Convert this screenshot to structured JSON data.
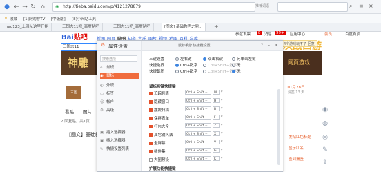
{
  "browser": {
    "url": "http://tieba.baidu.com/p/4121278879",
    "toolbar_right": "推荐词语",
    "favorites": [
      "收藏",
      "[1]网购秒TV",
      "[中级版]",
      "[8]小网站工具"
    ],
    "tabs": [
      "hao123_上网从这里开始",
      "三国志11吧_百度贴吧",
      "三国志11吧_百度贴吧",
      "[图文] 基础教程之完..."
    ]
  },
  "page": {
    "logo_main": "Bai",
    "logo_accent": "贴吧",
    "nav": [
      "新闻",
      "网页",
      "贴吧",
      "知道",
      "音乐",
      "图片",
      "视频",
      "地图",
      "百科",
      "文库"
    ],
    "nav_current": "贴吧",
    "search_value": "三国志11",
    "top_right": [
      "参献发票",
      "8",
      "消息",
      "99+",
      "应用中心",
      "会员",
      "百度首页"
    ],
    "notice": "4个游戏玩不了 回复",
    "banner_left": "神雕",
    "banner_right": "网页游戏",
    "game_tag": "决战西游",
    "forum_img": "三国",
    "sign": {
      "date": "01月28日",
      "status": "漏签 13 天"
    },
    "tabs2": [
      "看贴",
      "图片"
    ],
    "stats": "2 回复贴，共1页",
    "post_title": "【图文】基础教",
    "right_links": [
      "发帖红色标题",
      "显示红名",
      "签到漏签"
    ]
  },
  "dialog": {
    "title": "属性设置",
    "search_placeholder": "搜索选项",
    "side_items": [
      {
        "icon": "home-icon",
        "glyph": "⌂",
        "label": "常规"
      },
      {
        "icon": "mouse-icon",
        "glyph": "◉",
        "label": "鼠标"
      },
      {
        "icon": "appearance-icon",
        "glyph": "◐",
        "label": "外观"
      },
      {
        "icon": "tab-icon",
        "glyph": "▭",
        "label": "标签"
      },
      {
        "icon": "account-icon",
        "glyph": "☺",
        "label": "帐户"
      },
      {
        "icon": "advanced-icon",
        "glyph": "⚙",
        "label": "高级"
      },
      {
        "icon": "addon-icon",
        "glyph": "▣",
        "label": "插入选择器"
      },
      {
        "icon": "addon2-icon",
        "glyph": "▣",
        "label": "插入选择器"
      },
      {
        "icon": "shortcut-icon",
        "glyph": "✎",
        "label": "快捷设置列表"
      }
    ],
    "active_index": 1,
    "inner_title": "鼠标手势 快捷键设置",
    "options": [
      {
        "label": "三键设置",
        "choices": [
          "左右键",
          "双击右键",
          "另单击左键"
        ],
        "selected": 1
      },
      {
        "label": "快捷拖拽",
        "choices": [
          "Ctrl+数字",
          "Ctrl+Shift+数字",
          "无"
        ],
        "selected": 0
      },
      {
        "label": "快捷截图",
        "choices": [
          "Ctrl+数字",
          "Ctrl+Shift+数字",
          "无"
        ],
        "selected": 2
      }
    ],
    "section_shortcuts": "鼠标按键快捷键",
    "shortcuts": [
      {
        "label": "追踪列表",
        "keys": "Ctrl + Shift +",
        "key": "M",
        "on": true
      },
      {
        "label": "隐藏窗口",
        "keys": "Ctrl + Shift +",
        "key": "H",
        "on": true
      },
      {
        "label": "摆脱扫描",
        "keys": "Ctrl + Shift +",
        "key": "B",
        "on": true
      },
      {
        "label": "保存表单",
        "keys": "Ctrl + Shift +",
        "key": "F",
        "on": true
      },
      {
        "label": "打包大全",
        "keys": "Ctrl + Shift +",
        "key": "Z",
        "on": true
      },
      {
        "label": "其它输入法",
        "keys": "Ctrl + Shift +",
        "key": "X",
        "on": true
      },
      {
        "label": "全屏幕",
        "keys": "Ctrl + Shift +",
        "key": "V",
        "on": true
      },
      {
        "label": "插件集",
        "keys": "Ctrl + Shift +",
        "key": "G",
        "on": true
      },
      {
        "label": "大图预设",
        "keys": "Ctrl + Shift +",
        "key": "K",
        "on": false
      }
    ],
    "section_bottom": "扩展功能快捷键"
  },
  "colors": {
    "accent": "#f06c3d",
    "link": "#2b5fd9",
    "radio": "#3c84e0"
  }
}
